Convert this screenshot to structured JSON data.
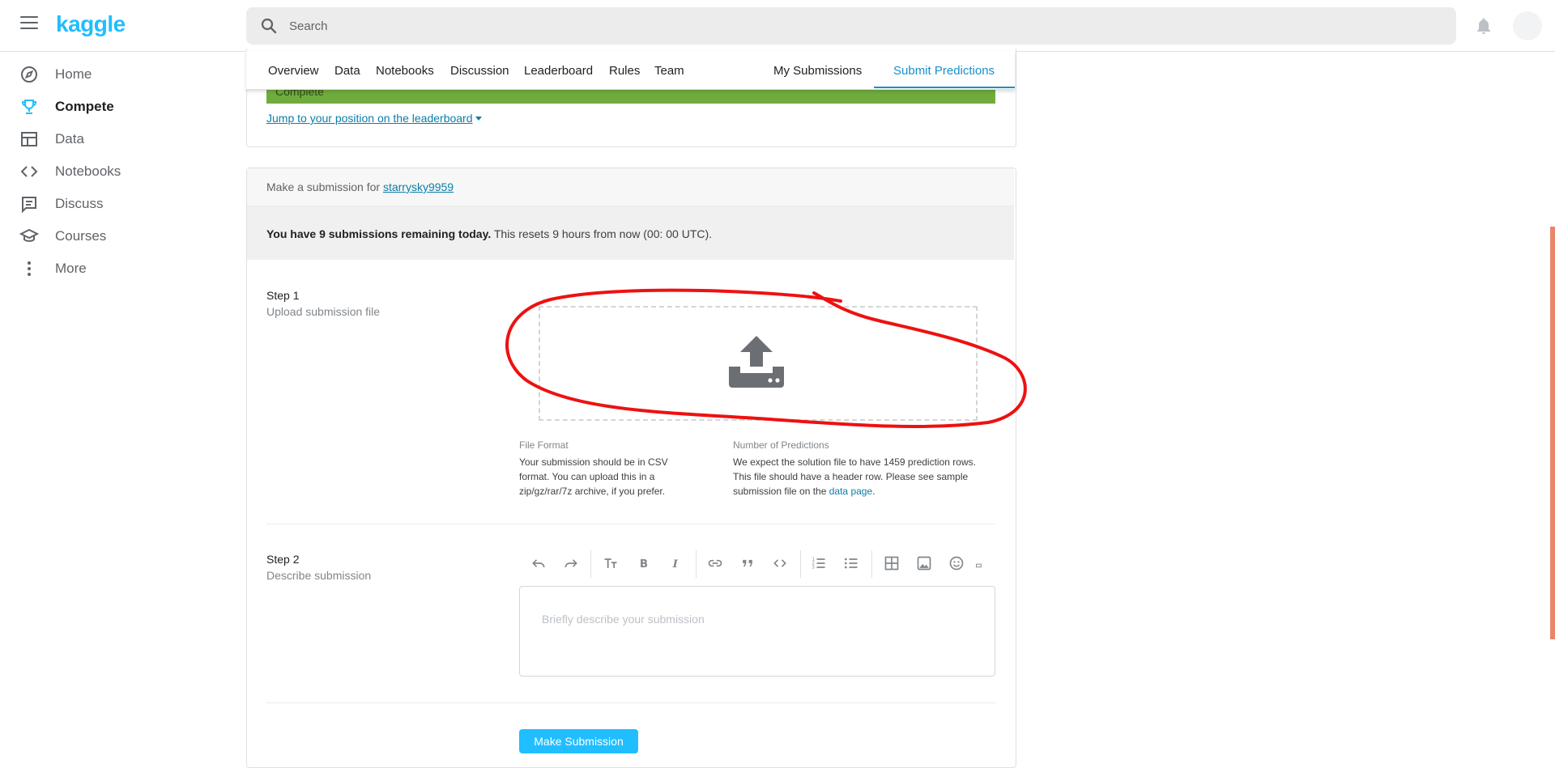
{
  "brand": {
    "logo_text": "kaggle",
    "accent": "#20beff"
  },
  "search": {
    "placeholder": "Search"
  },
  "sidebar": {
    "items": [
      {
        "label": "Home",
        "icon": "compass-icon"
      },
      {
        "label": "Compete",
        "icon": "trophy-icon",
        "active": true
      },
      {
        "label": "Data",
        "icon": "table-icon"
      },
      {
        "label": "Notebooks",
        "icon": "code-icon"
      },
      {
        "label": "Discuss",
        "icon": "comment-icon"
      },
      {
        "label": "Courses",
        "icon": "graduation-cap-icon"
      },
      {
        "label": "More",
        "icon": "more-vert-icon"
      }
    ]
  },
  "tabs": {
    "overview": "Overview",
    "data": "Data",
    "notebooks": "Notebooks",
    "discussion": "Discussion",
    "leaderboard": "Leaderboard",
    "rules": "Rules",
    "team": "Team",
    "my_submissions": "My Submissions",
    "submit_predictions": "Submit Predictions",
    "active": "Submit Predictions"
  },
  "status": {
    "progress_label": "Complete",
    "progress_color": "#6fac3d"
  },
  "leaderboard_link": "Jump to your position on the leaderboard",
  "submission": {
    "header_prefix": "Make a submission for",
    "username": "starrysky9959",
    "remaining_bold": "You have 9 submissions remaining today.",
    "remaining_rest": "This resets 9 hours from now (00: 00 UTC)."
  },
  "step1": {
    "title": "Step 1",
    "subtitle": "Upload submission file",
    "file_format_label": "File Format",
    "file_format_text": "Your submission should be in CSV format. You can upload this in a zip/gz/rar/7z archive, if you prefer.",
    "predictions_label": "Number of Predictions",
    "predictions_text": "We expect the solution file to have 1459 prediction rows. This file should have a header row. Please see sample submission file on the",
    "data_page_link": "data page",
    "predictions_tail": "."
  },
  "step2": {
    "title": "Step 2",
    "subtitle": "Describe submission",
    "placeholder": "Briefly describe your submission"
  },
  "submit_button": "Make Submission"
}
